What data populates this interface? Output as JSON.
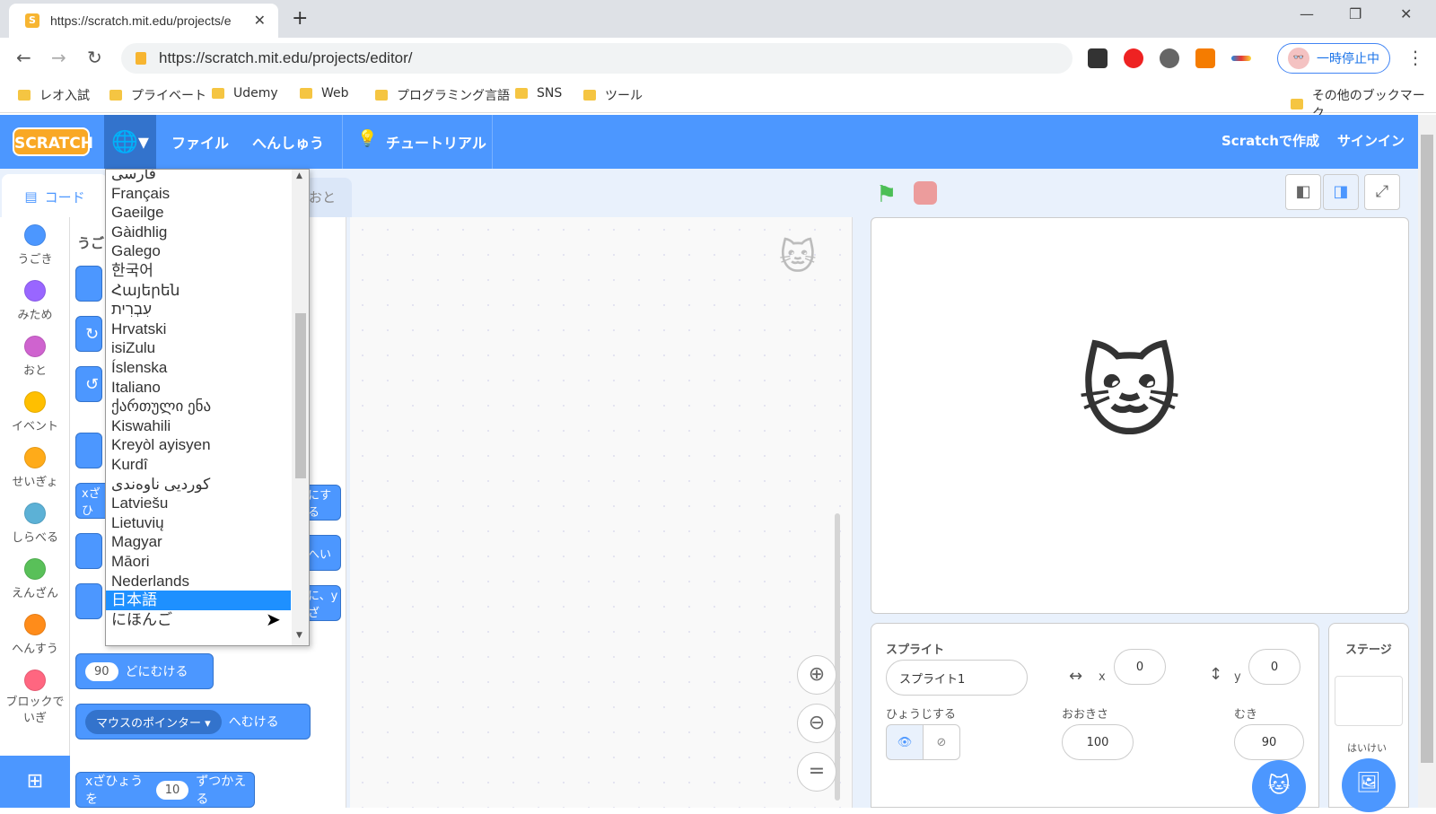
{
  "browser": {
    "tab_title": "https://scratch.mit.edu/projects/e",
    "url": "https://scratch.mit.edu/projects/editor/",
    "profile_status": "一時停止中",
    "bookmarks": [
      "レオ入試",
      "プライベート",
      "Udemy",
      "Web",
      "プログラミング言語",
      "SNS",
      "ツール"
    ],
    "other_bookmarks": "その他のブックマーク"
  },
  "menu": {
    "logo": "SCRATCH",
    "file": "ファイル",
    "edit": "へんしゅう",
    "tutorial": "チュートリアル",
    "create": "Scratchで作成",
    "signin": "サインイン"
  },
  "tabs": {
    "code": "コード",
    "sounds": "おと"
  },
  "categories": [
    {
      "label": "うごき",
      "color": "#4c97ff"
    },
    {
      "label": "みため",
      "color": "#9966ff"
    },
    {
      "label": "おと",
      "color": "#cf63cf"
    },
    {
      "label": "イベント",
      "color": "#ffbf00"
    },
    {
      "label": "せいぎょ",
      "color": "#ffab19"
    },
    {
      "label": "しらべる",
      "color": "#5cb1d6"
    },
    {
      "label": "えんざん",
      "color": "#59c059"
    },
    {
      "label": "へんすう",
      "color": "#ff8c1a"
    },
    {
      "label": "ブロックで\nいぎ",
      "color": "#ff6680"
    }
  ],
  "palette": {
    "heading": "うご",
    "block_turn_to_val": "90",
    "block_turn_to_suffix": "どにむける",
    "block_point_towards_target": "マウスのポインター",
    "block_point_towards_suffix": "へむける",
    "block_glide_prefix": "xざひ",
    "block_glide_suffix": "にする",
    "block_glide2_suffix": "へい",
    "block_glide3_suffix": "に、yざ",
    "block_bottom_prefix": "xざひょうを",
    "block_bottom_val": "10",
    "block_bottom_suffix": "ずつかえる"
  },
  "language_dropdown": {
    "options": [
      "فارسی",
      "Français",
      "Gaeilge",
      "Gàidhlig",
      "Galego",
      "한국어",
      "Հայերեն",
      "עִבְרִית",
      "Hrvatski",
      "isiZulu",
      "Íslenska",
      "Italiano",
      "ქართული ენა",
      "Kiswahili",
      "Kreyòl ayisyen",
      "Kurdî",
      "کوردیی ناوەندی",
      "Latviešu",
      "Lietuvių",
      "Magyar",
      "Māori",
      "Nederlands",
      "日本語",
      "にほんご"
    ],
    "selected": "日本語"
  },
  "sprite_info": {
    "sprite_label": "スプライト",
    "sprite_name": "スプライト1",
    "x_label": "x",
    "x_value": "0",
    "y_label": "y",
    "y_value": "0",
    "show_label": "ひょうじする",
    "size_label": "おおきさ",
    "size_value": "100",
    "direction_label": "むき",
    "direction_value": "90"
  },
  "stage_pane": {
    "title": "ステージ",
    "backdrop_label": "はいけい"
  }
}
